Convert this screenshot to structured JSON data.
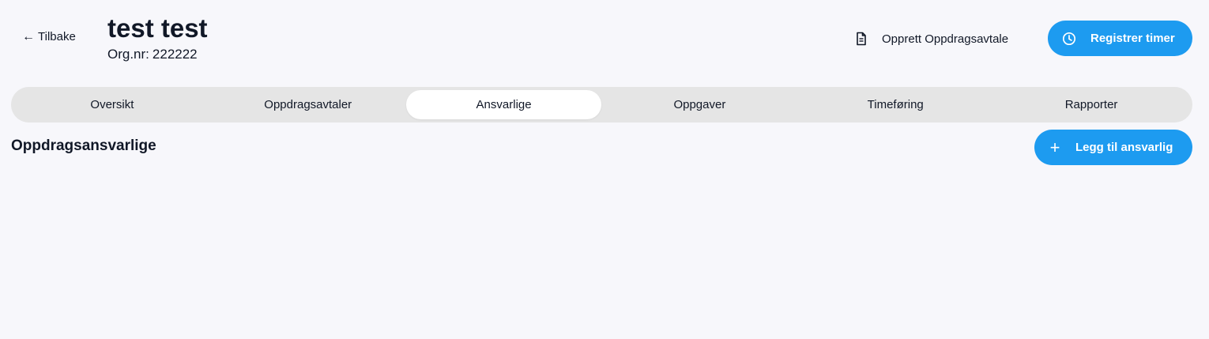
{
  "header": {
    "back_label": "Tilbake",
    "back_icon": "arrow-left-icon",
    "company_name": "test test",
    "org_label": "Org.nr:",
    "org_number": "222222",
    "create_agreement_label": "Opprett Oppdragsavtale",
    "create_agreement_icon": "document-icon",
    "register_time_label": "Registrer timer",
    "register_time_icon": "clock-icon"
  },
  "tabs": [
    {
      "label": "Oversikt",
      "active": false
    },
    {
      "label": "Oppdragsavtaler",
      "active": false
    },
    {
      "label": "Ansvarlige",
      "active": true
    },
    {
      "label": "Oppgaver",
      "active": false
    },
    {
      "label": "Timeføring",
      "active": false
    },
    {
      "label": "Rapporter",
      "active": false
    }
  ],
  "section": {
    "title": "Oppdragsansvarlige",
    "add_button_label": "Legg til ansvarlig",
    "add_button_icon": "plus-icon"
  },
  "colors": {
    "accent": "#1d9bf0",
    "background": "#f7f7fb",
    "tab_bar": "#e5e5e5",
    "tab_active": "#ffffff"
  }
}
